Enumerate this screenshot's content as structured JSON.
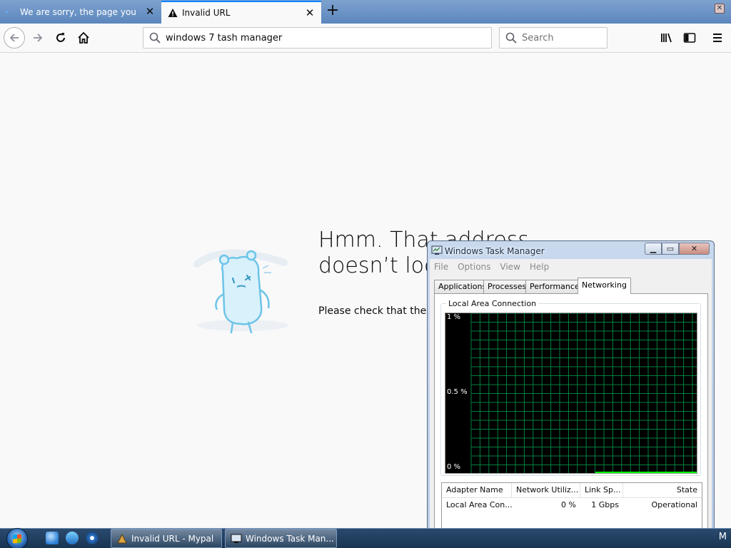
{
  "browser": {
    "tabs": [
      {
        "title": "We are sorry, the page you requested cannot be found",
        "active": false
      },
      {
        "title": "Invalid URL",
        "active": true
      }
    ],
    "url_value": "windows 7 tash  manager",
    "search_placeholder": "Search",
    "accent_color": "#0a84ff"
  },
  "error_page": {
    "title_line1": "Hmm. That address",
    "title_line2": "doesn’t look right.",
    "description": "Please check that the URL is correct and try again."
  },
  "task_manager": {
    "title": "Windows Task Manager",
    "menu": [
      "File",
      "Options",
      "View",
      "Help"
    ],
    "tabs": [
      "Applications",
      "Processes",
      "Performance",
      "Networking"
    ],
    "active_tab": "Networking",
    "group_label": "Local Area Connection",
    "graph": {
      "y_labels": [
        "1 %",
        "0.5 %",
        "0 %"
      ],
      "grid_color": "#008040",
      "line_color": "#00ff00"
    },
    "columns": [
      "Adapter Name",
      "Network Utiliz...",
      "Link Sp...",
      "State"
    ],
    "rows": [
      [
        "Local Area Con...",
        "0 %",
        "1 Gbps",
        "Operational"
      ]
    ]
  },
  "taskbar": {
    "buttons": [
      "Invalid URL - Mypal",
      "Windows Task Man..."
    ],
    "tray_text": "M"
  }
}
